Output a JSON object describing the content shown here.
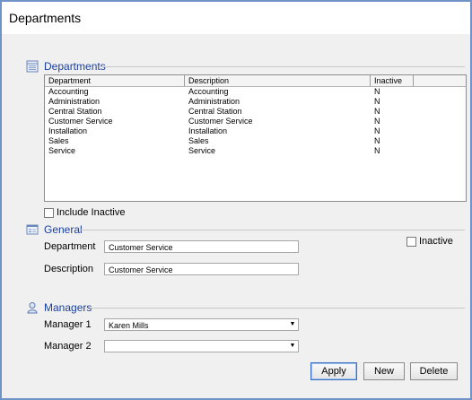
{
  "window": {
    "title": "Departments"
  },
  "sections": {
    "departments": {
      "label": "Departments"
    },
    "general": {
      "label": "General"
    },
    "managers": {
      "label": "Managers"
    }
  },
  "grid": {
    "columns": [
      "Department",
      "Description",
      "Inactive"
    ],
    "rows": [
      [
        "Accounting",
        "Accounting",
        "N"
      ],
      [
        "Administration",
        "Administration",
        "N"
      ],
      [
        "Central Station",
        "Central Station",
        "N"
      ],
      [
        "Customer Service",
        "Customer Service",
        "N"
      ],
      [
        "Installation",
        "Installation",
        "N"
      ],
      [
        "Sales",
        "Sales",
        "N"
      ],
      [
        "Service",
        "Service",
        "N"
      ]
    ]
  },
  "include_inactive": {
    "label": "Include Inactive",
    "checked": false
  },
  "general": {
    "department_label": "Department",
    "department_value": "Customer Service",
    "description_label": "Description",
    "description_value": "Customer Service",
    "inactive_label": "Inactive",
    "inactive_checked": false
  },
  "managers": {
    "manager1_label": "Manager 1",
    "manager1_value": "Karen Mills",
    "manager2_label": "Manager 2",
    "manager2_value": ""
  },
  "buttons": {
    "apply": "Apply",
    "new": "New",
    "delete": "Delete"
  },
  "icons": {
    "departments": "list-grid-icon",
    "general": "form-icon",
    "managers": "user-icon",
    "dropdown": "chevron-down-icon"
  }
}
